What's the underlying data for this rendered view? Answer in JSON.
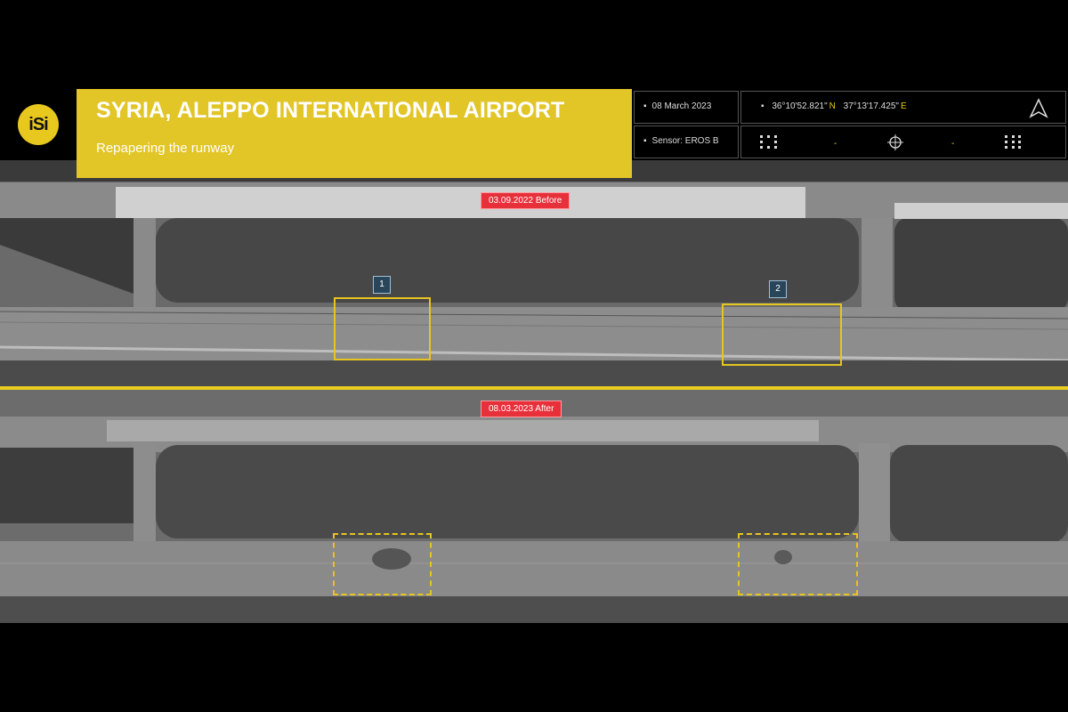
{
  "header": {
    "logo_text": "iSi",
    "title": "SYRIA, ALEPPO INTERNATIONAL AIRPORT",
    "subtitle": "Repapering the runway"
  },
  "info": {
    "date": "08 March 2023",
    "sensor": "Sensor: EROS B",
    "lat": "36°10'52.821\"",
    "lat_dir": "N",
    "lon": "37°13'17.425\"",
    "lon_dir": "E"
  },
  "labels": {
    "before": "03.09.2022 Before",
    "after": "08.03.2023 After",
    "marker_1": "1",
    "marker_2": "2"
  },
  "colors": {
    "accent_yellow": "#e2c526",
    "tag_red": "#e8303a",
    "marker_blue": "#28455a"
  }
}
